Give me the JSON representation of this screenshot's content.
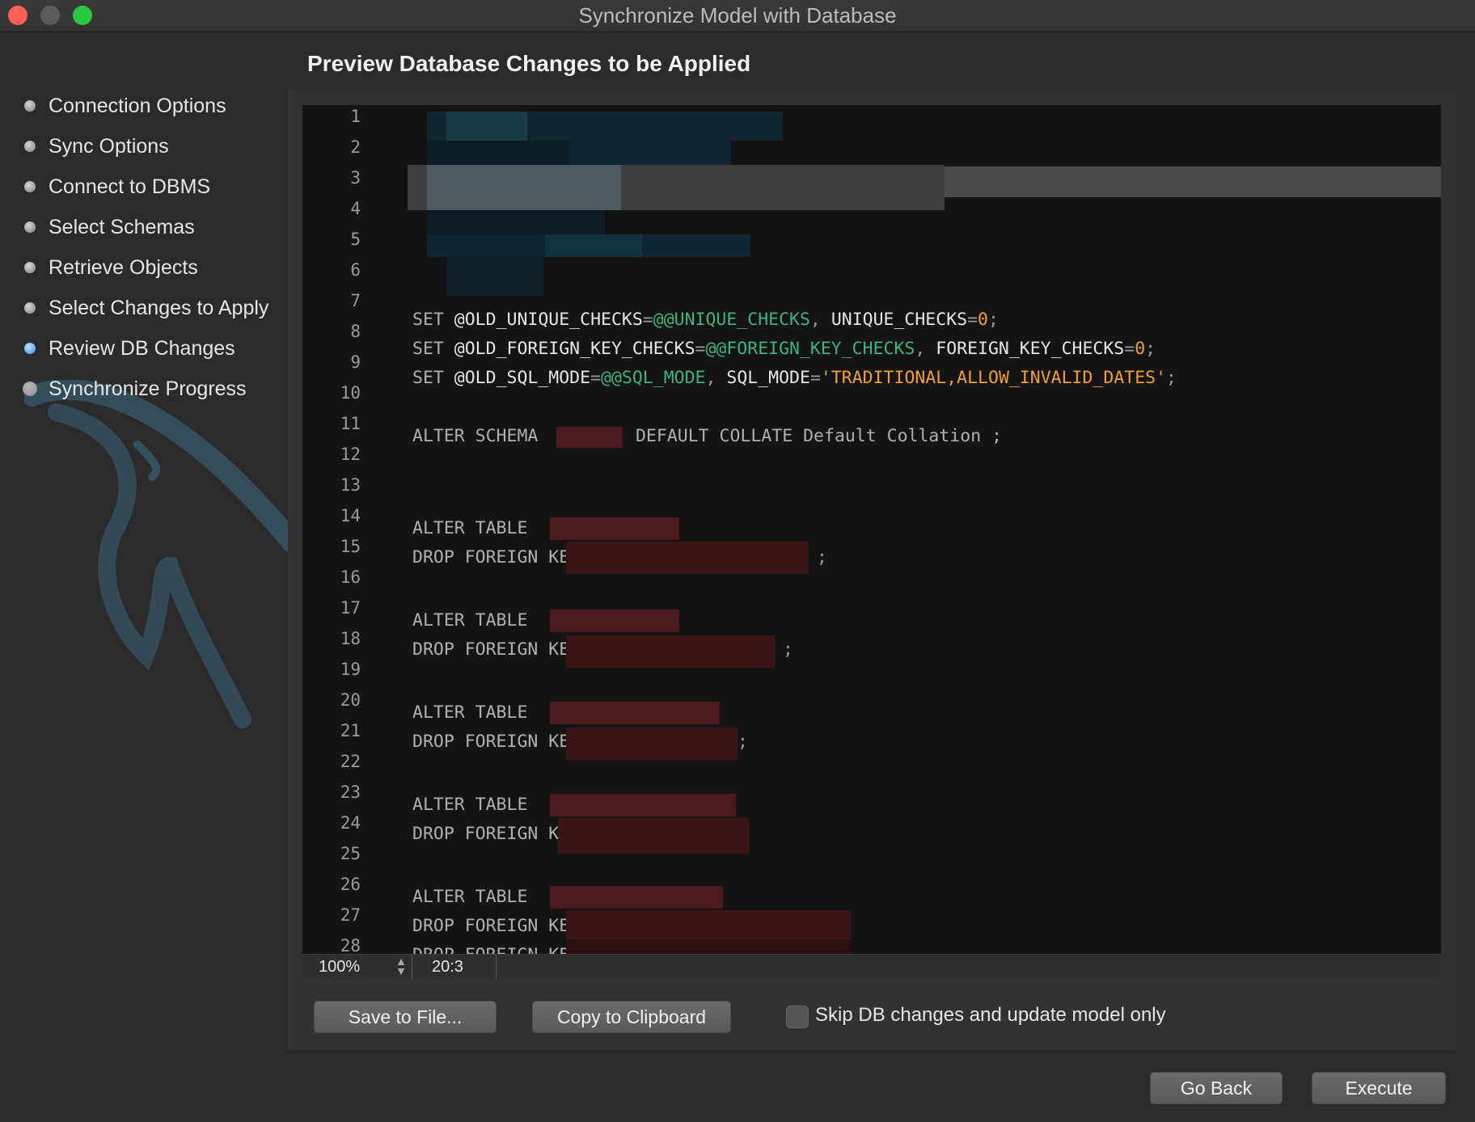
{
  "window": {
    "title": "Synchronize Model with Database"
  },
  "sidebar": {
    "steps": [
      {
        "label": "Connection Options",
        "state": "done"
      },
      {
        "label": "Sync Options",
        "state": "done"
      },
      {
        "label": "Connect to DBMS",
        "state": "done"
      },
      {
        "label": "Select Schemas",
        "state": "done"
      },
      {
        "label": "Retrieve Objects",
        "state": "done"
      },
      {
        "label": "Select Changes to Apply",
        "state": "done"
      },
      {
        "label": "Review DB Changes",
        "state": "active"
      },
      {
        "label": "Synchronize Progress",
        "state": "pending"
      }
    ]
  },
  "main": {
    "heading": "Preview Database Changes to be Applied",
    "editor": {
      "line_numbers": [
        "1",
        "2",
        "3",
        "4",
        "5",
        "6",
        "7",
        "8",
        "9",
        "10",
        "11",
        "12",
        "13",
        "14",
        "15",
        "16",
        "17",
        "18",
        "19",
        "20",
        "21",
        "22",
        "23",
        "24",
        "25",
        "26",
        "27",
        "28"
      ],
      "line8": {
        "kw": "SET",
        "a": "@OLD_UNIQUE_CHECKS",
        "eq": "=",
        "b": "@@UNIQUE_CHECKS",
        "sep": ", ",
        "c": "UNIQUE_CHECKS",
        "eq2": "=",
        "n": "0",
        "end": ";"
      },
      "line9": {
        "kw": "SET",
        "a": "@OLD_FOREIGN_KEY_CHECKS",
        "eq": "=",
        "b": "@@FOREIGN_KEY_CHECKS",
        "sep": ", ",
        "c": "FOREIGN_KEY_CHECKS",
        "eq2": "=",
        "n": "0",
        "end": ";"
      },
      "line10": {
        "kw": "SET",
        "a": "@OLD_SQL_MODE",
        "eq": "=",
        "b": "@@SQL_MODE",
        "sep": ", ",
        "c": "SQL_MODE",
        "eq2": "=",
        "s": "'TRADITIONAL,ALLOW_INVALID_DATES'",
        "end": ";"
      },
      "line12": {
        "a": "ALTER SCHEMA",
        "b": "DEFAULT COLLATE Default Collation ;"
      },
      "alter_table": "ALTER TABLE",
      "drop_fk": "DROP FOREIGN KEY",
      "semicolon": ";",
      "zoom": "100%",
      "cursor": "20:3"
    },
    "buttons": {
      "save": "Save to File...",
      "copy": "Copy to Clipboard"
    },
    "skip_checkbox": {
      "label": "Skip DB changes and update model only",
      "checked": false
    }
  },
  "footer": {
    "back": "Go Back",
    "execute": "Execute"
  }
}
